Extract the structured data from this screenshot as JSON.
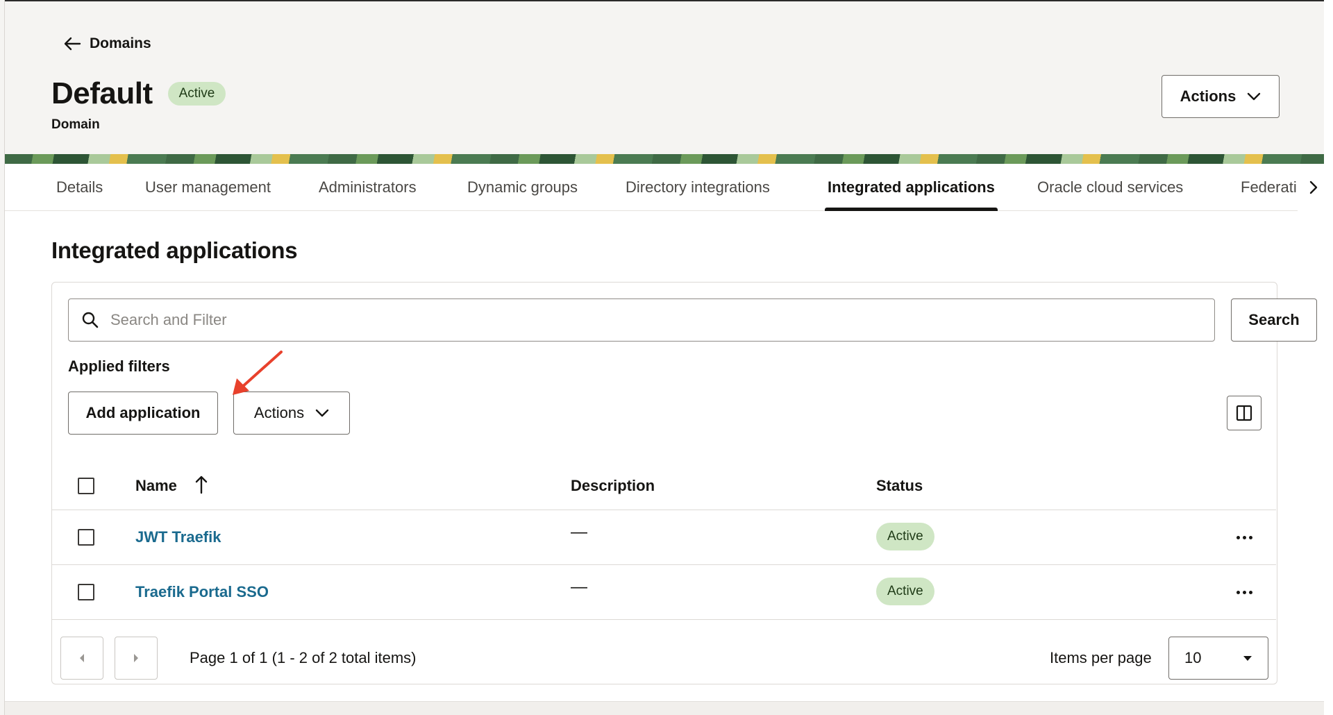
{
  "header": {
    "back_label": "Domains",
    "title": "Default",
    "status": "Active",
    "subtitle": "Domain",
    "actions_label": "Actions"
  },
  "tabs": [
    {
      "label": "Details"
    },
    {
      "label": "User management"
    },
    {
      "label": "Administrators"
    },
    {
      "label": "Dynamic groups"
    },
    {
      "label": "Directory integrations"
    },
    {
      "label": "Integrated applications",
      "active": true
    },
    {
      "label": "Oracle cloud services"
    },
    {
      "label": "Federation"
    }
  ],
  "section": {
    "title": "Integrated applications"
  },
  "search": {
    "placeholder": "Search and Filter",
    "button_label": "Search"
  },
  "filters": {
    "applied_label": "Applied filters"
  },
  "toolbar": {
    "add_label": "Add application",
    "actions_label": "Actions"
  },
  "table": {
    "columns": [
      "Name",
      "Description",
      "Status"
    ],
    "rows": [
      {
        "name": "JWT Traefik",
        "description": "—",
        "status": "Active"
      },
      {
        "name": "Traefik Portal SSO",
        "description": "—",
        "status": "Active"
      }
    ]
  },
  "pagination": {
    "summary": "Page 1 of 1 (1 - 2 of 2 total items)",
    "items_per_page_label": "Items per page",
    "items_per_page_value": "10"
  },
  "colors": {
    "badge_bg": "#cfe6c4",
    "link": "#1a6a8e",
    "annotation_arrow": "#e8412c"
  },
  "icons": [
    "arrow-left-icon",
    "chevron-down-icon",
    "chevron-right-icon",
    "search-icon",
    "columns-icon",
    "sort-ascending-icon",
    "more-icon",
    "caret-left-icon",
    "caret-right-icon",
    "caret-down-icon",
    "annotation-arrow"
  ]
}
